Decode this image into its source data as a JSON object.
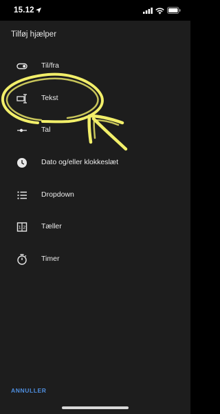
{
  "status_bar": {
    "time": "15.12",
    "icons": [
      "location-arrow-icon",
      "signal-icon",
      "wifi-icon",
      "battery-icon"
    ]
  },
  "dialog": {
    "title": "Tilføj hjælper",
    "items": [
      {
        "label": "Til/fra",
        "icon": "toggle-icon"
      },
      {
        "label": "Tekst",
        "icon": "text-field-icon"
      },
      {
        "label": "Tal",
        "icon": "slider-icon"
      },
      {
        "label": "Dato og/eller klokkeslæt",
        "icon": "clock-icon"
      },
      {
        "label": "Dropdown",
        "icon": "list-icon"
      },
      {
        "label": "Tæller",
        "icon": "counter-icon"
      },
      {
        "label": "Timer",
        "icon": "timer-icon"
      }
    ],
    "cancel_label": "ANNULLER"
  },
  "colors": {
    "background": "#1d1d1d",
    "accent": "#4f8fe0",
    "annotation": "#f2ef6a"
  }
}
